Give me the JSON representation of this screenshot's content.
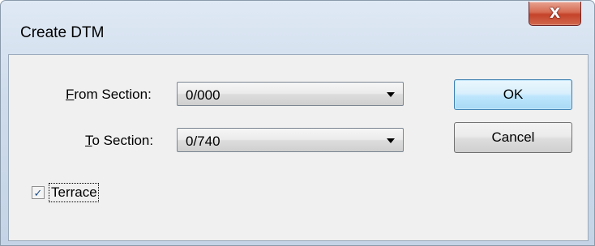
{
  "window": {
    "title": "Create DTM",
    "close_glyph": "X"
  },
  "form": {
    "from_section": {
      "label_accel": "F",
      "label_rest": "rom Section:",
      "value": "0/000"
    },
    "to_section": {
      "label_accel": "T",
      "label_rest": "o Section:",
      "value": "0/740"
    },
    "terrace": {
      "label": "Terrace",
      "checked": true,
      "check_glyph": "✓"
    }
  },
  "buttons": {
    "ok_label": "OK",
    "cancel_label": "Cancel"
  },
  "icons": {
    "close": "close-icon",
    "dropdown": "chevron-down-icon",
    "check": "checkmark-icon"
  },
  "colors": {
    "titlebar": "#cfdceb",
    "client_bg": "#f0f0f0",
    "close_button": "#c4432a",
    "default_button_border": "#3c7fb1"
  }
}
